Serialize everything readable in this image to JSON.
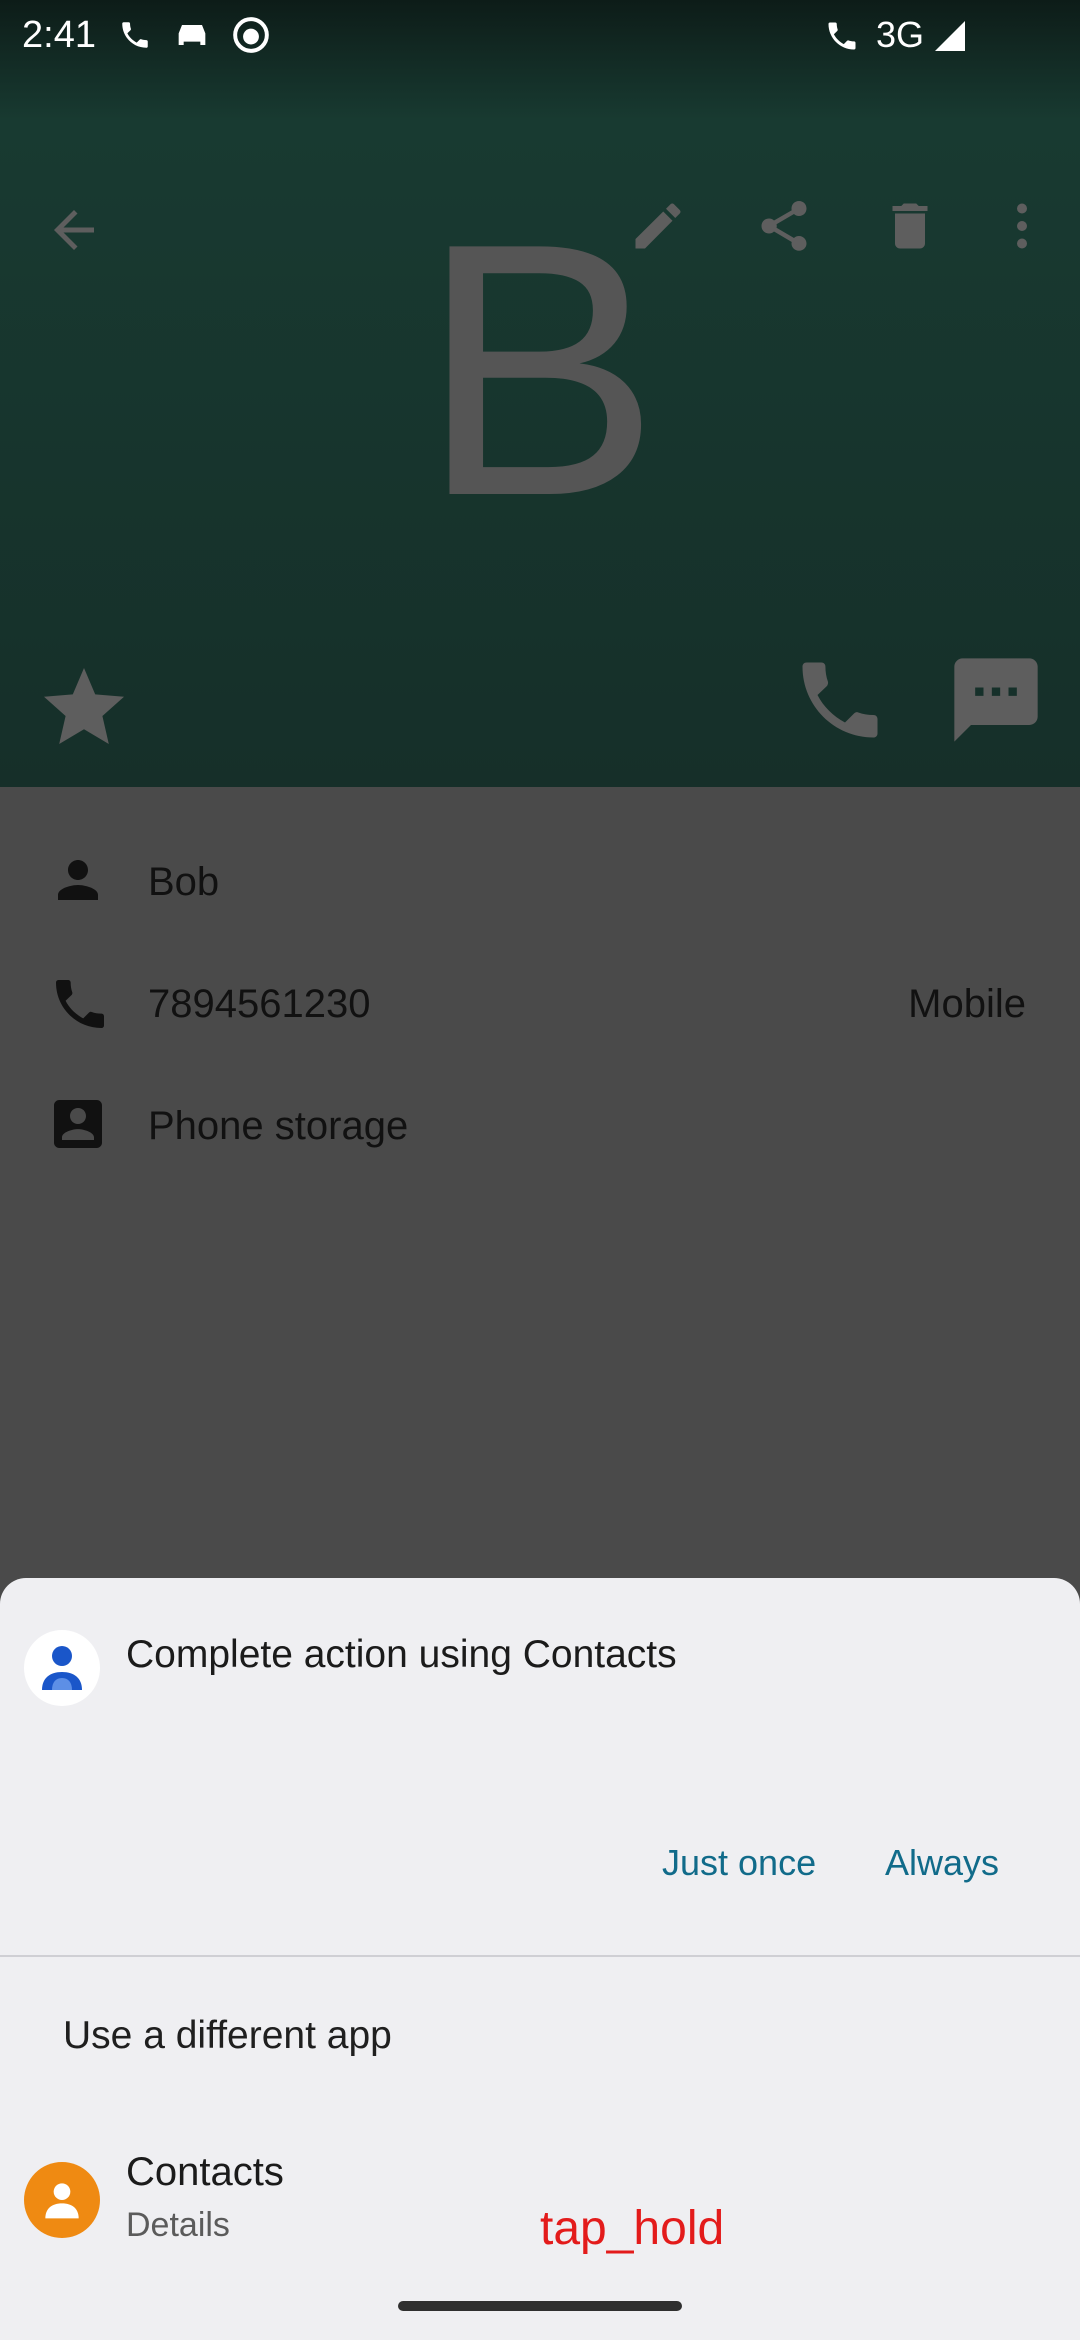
{
  "status_bar": {
    "time": "2:41",
    "network": "3G"
  },
  "header": {
    "avatar_letter": "B",
    "icons": [
      "back-arrow-icon",
      "edit-icon",
      "share-icon",
      "delete-icon",
      "more-vert-icon",
      "star-icon",
      "phone-icon",
      "message-icon"
    ]
  },
  "contact": {
    "name": "Bob",
    "phone": "7894561230",
    "phone_type": "Mobile",
    "account": "Phone storage"
  },
  "sheet": {
    "title": "Complete action using Contacts",
    "just_once": "Just once",
    "always": "Always",
    "different_app": "Use a different app",
    "app_name": "Contacts",
    "app_sub": "Details"
  },
  "overlay": {
    "label": "tap_hold"
  },
  "colors": {
    "accent_button": "#116b8a",
    "overlay_label": "#e31b1b",
    "app_icon_orange": "#ef8a12",
    "contacts_blue": "#1a56c9"
  }
}
